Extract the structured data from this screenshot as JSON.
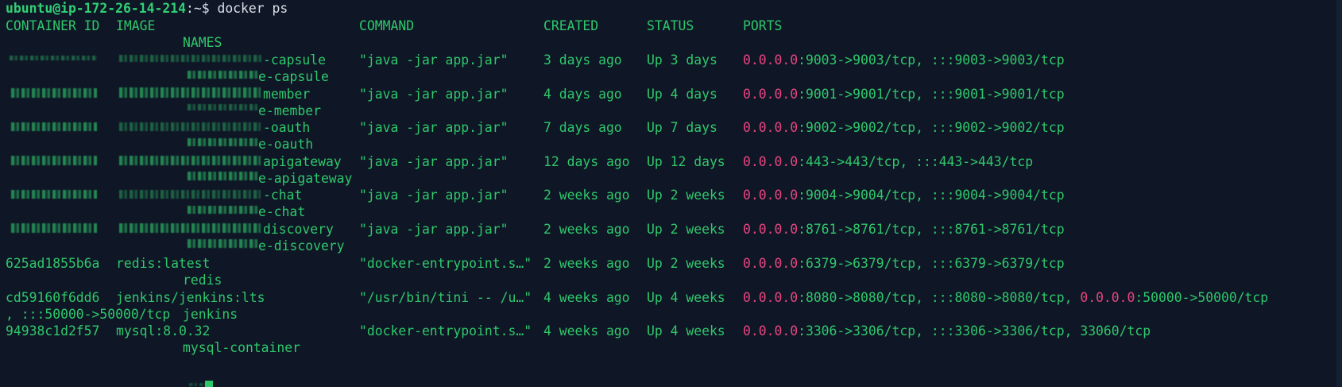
{
  "prompt": {
    "host": "ubuntu@ip-172-26-14-214",
    "path": ":~$",
    "command": " docker ps"
  },
  "headers": {
    "container_id": "CONTAINER ID",
    "image": "IMAGE",
    "command": "COMMAND",
    "created": "CREATED",
    "status": "STATUS",
    "ports": "PORTS",
    "names": "NAMES"
  },
  "rows": [
    {
      "container_id": "",
      "image_suffix": "-capsule",
      "command": "\"java -jar app.jar\"",
      "created": "3 days ago",
      "status": "Up 3 days",
      "ports_ip": "0.0.0.0",
      "ports_rest": ":9003->9003/tcp, :::9003->9003/tcp",
      "name_suffix": "e-capsule"
    },
    {
      "container_id": "",
      "image_suffix": "member",
      "command": "\"java -jar app.jar\"",
      "created": "4 days ago",
      "status": "Up 4 days",
      "ports_ip": "0.0.0.0",
      "ports_rest": ":9001->9001/tcp, :::9001->9001/tcp",
      "name_suffix": "e-member"
    },
    {
      "container_id": "",
      "image_suffix": "-oauth",
      "command": "\"java -jar app.jar\"",
      "created": "7 days ago",
      "status": "Up 7 days",
      "ports_ip": "0.0.0.0",
      "ports_rest": ":9002->9002/tcp, :::9002->9002/tcp",
      "name_suffix": "e-oauth"
    },
    {
      "container_id": "",
      "image_suffix": "apigateway",
      "command": "\"java -jar app.jar\"",
      "created": "12 days ago",
      "status": "Up 12 days",
      "ports_ip": "0.0.0.0",
      "ports_rest": ":443->443/tcp, :::443->443/tcp",
      "name_suffix": "e-apigateway"
    },
    {
      "container_id": "",
      "image_suffix": "-chat",
      "command": "\"java -jar app.jar\"",
      "created": "2 weeks ago",
      "status": "Up 2 weeks",
      "ports_ip": "0.0.0.0",
      "ports_rest": ":9004->9004/tcp, :::9004->9004/tcp",
      "name_suffix": "e-chat"
    },
    {
      "container_id": "",
      "image_suffix": "discovery",
      "command": "\"java -jar app.jar\"",
      "created": "2 weeks ago",
      "status": "Up 2 weeks",
      "ports_ip": "0.0.0.0",
      "ports_rest": ":8761->8761/tcp, :::8761->8761/tcp",
      "name_suffix": "e-discovery"
    },
    {
      "container_id": "625ad1855b6a",
      "image": "redis:latest",
      "command": "\"docker-entrypoint.s…\"",
      "created": "2 weeks ago",
      "status": "Up 2 weeks",
      "ports_ip": "0.0.0.0",
      "ports_rest": ":6379->6379/tcp, :::6379->6379/tcp",
      "name": "redis"
    },
    {
      "container_id": "cd59160f6dd6",
      "image": "jenkins/jenkins:lts",
      "command": "\"/usr/bin/tini -- /u…\"",
      "created": "4 weeks ago",
      "status": "Up 4 weeks",
      "ports_ip": "0.0.0.0",
      "ports_rest": ":8080->8080/tcp, :::8080->8080/tcp, ",
      "ports_ip2": "0.0.0.0",
      "ports_rest2": ":50000->50000/tcp",
      "wrap": ", :::50000->50000/tcp",
      "name": "jenkins"
    },
    {
      "container_id": "94938c1d2f57",
      "image": "mysql:8.0.32",
      "command": "\"docker-entrypoint.s…\"",
      "created": "4 weeks ago",
      "status": "Up 4 weeks",
      "ports_ip": "0.0.0.0",
      "ports_rest": ":3306->3306/tcp, :::3306->3306/tcp, 33060/tcp",
      "name": "mysql-container"
    }
  ]
}
